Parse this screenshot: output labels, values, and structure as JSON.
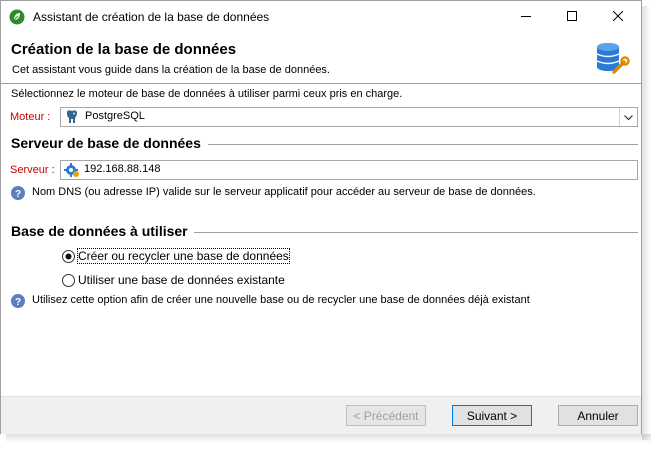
{
  "window": {
    "title": "Assistant de création de la base de données"
  },
  "header": {
    "title": "Création de la base de données",
    "subtitle": "Cet assistant vous guide dans la création de la base de données."
  },
  "engine": {
    "intro": "Sélectionnez le moteur de base de données à utiliser parmi ceux pris en charge.",
    "label": "Moteur :",
    "value": "PostgreSQL",
    "label_color": "#cc0000"
  },
  "server_section": {
    "title": "Serveur de base de données",
    "label": "Serveur :",
    "value": "192.168.88.148",
    "help": "Nom DNS (ou adresse IP) valide sur le serveur applicatif pour accéder au serveur de base de données."
  },
  "db_section": {
    "title": "Base de données à utiliser",
    "options": [
      {
        "label": "Créer ou recycler une base de données",
        "selected": true
      },
      {
        "label": "Utiliser une base de données existante",
        "selected": false
      }
    ],
    "help": "Utilisez cette option afin de créer une nouvelle base ou de recycler une base de données déjà existant"
  },
  "footer": {
    "prev_label": "< Précédent",
    "next_label": "Suivant >",
    "cancel_label": "Annuler"
  },
  "icons": {
    "app": "app-leaf-icon",
    "database": "database-wrench-icon",
    "postgres": "postgresql-elephant-icon",
    "server": "server-gear-icon",
    "help": "help-question-icon"
  }
}
